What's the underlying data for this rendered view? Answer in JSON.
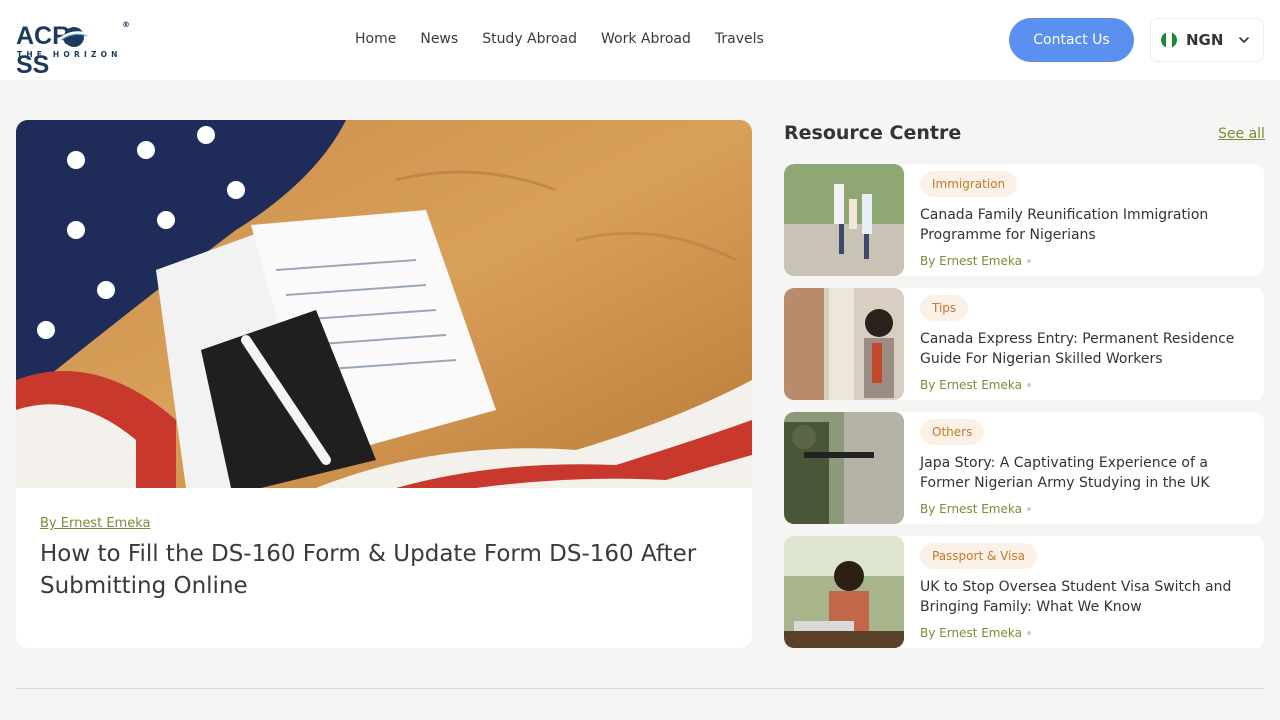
{
  "header": {
    "logo": {
      "text": "ACROSS",
      "subtitle": "THE HORIZON",
      "reg": "®"
    },
    "nav": [
      "Home",
      "News",
      "Study Abroad",
      "Work Abroad",
      "Travels"
    ],
    "contact_label": "Contact Us",
    "currency": {
      "code": "NGN",
      "flag_icon": "nigeria-flag-icon"
    }
  },
  "featured": {
    "author": "By Ernest Emeka",
    "title": "How to Fill the DS-160 Form & Update Form DS-160 After Submitting Online"
  },
  "resource_centre": {
    "title": "Resource Centre",
    "see_all": "See all",
    "items": [
      {
        "tag": "Immigration",
        "headline": "Canada Family Reunification Immigration Programme for Nigerians",
        "author": "By Ernest Emeka"
      },
      {
        "tag": "Tips",
        "headline": "Canada Express Entry: Permanent Residence Guide For Nigerian Skilled Workers",
        "author": "By Ernest Emeka"
      },
      {
        "tag": "Others",
        "headline": "Japa Story: A Captivating Experience of a Former Nigerian Army Studying in the UK",
        "author": "By Ernest Emeka"
      },
      {
        "tag": "Passport & Visa",
        "headline": "UK to Stop Oversea Student Visa Switch and Bringing Family: What We Know",
        "author": "By Ernest Emeka"
      }
    ]
  },
  "colors": {
    "accent_blue": "#5b8ff0",
    "author_green": "#7a8c36",
    "tag_bg": "#fcf1e6",
    "tag_text": "#c47a2a",
    "page_bg": "#f5f5f4"
  }
}
